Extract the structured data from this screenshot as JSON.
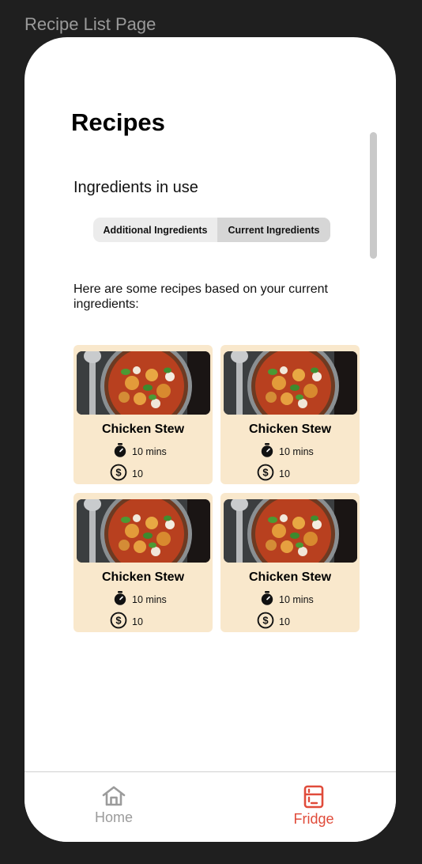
{
  "frame_label": "Recipe List Page",
  "page": {
    "title": "Recipes",
    "subtitle": "Ingredients in use",
    "segments": [
      {
        "label": "Additional Ingredients",
        "selected": false
      },
      {
        "label": "Current Ingredients",
        "selected": true
      }
    ],
    "intro": "Here are some recipes based on your current ingredients:"
  },
  "recipes": [
    {
      "name": "Chicken Stew",
      "time": "10 mins",
      "cost": "10"
    },
    {
      "name": "Chicken Stew",
      "time": "10 mins",
      "cost": "10"
    },
    {
      "name": "Chicken Stew",
      "time": "10 mins",
      "cost": "10"
    },
    {
      "name": "Chicken Stew",
      "time": "10 mins",
      "cost": "10"
    }
  ],
  "nav": {
    "home": {
      "label": "Home",
      "icon": "home-icon"
    },
    "fridge": {
      "label": "Fridge",
      "icon": "fridge-icon",
      "active": true
    }
  },
  "colors": {
    "background": "#1f1f1f",
    "card": "#f9e8cc",
    "active_nav": "#e04b3a",
    "inactive_nav": "#9b9b9b"
  }
}
